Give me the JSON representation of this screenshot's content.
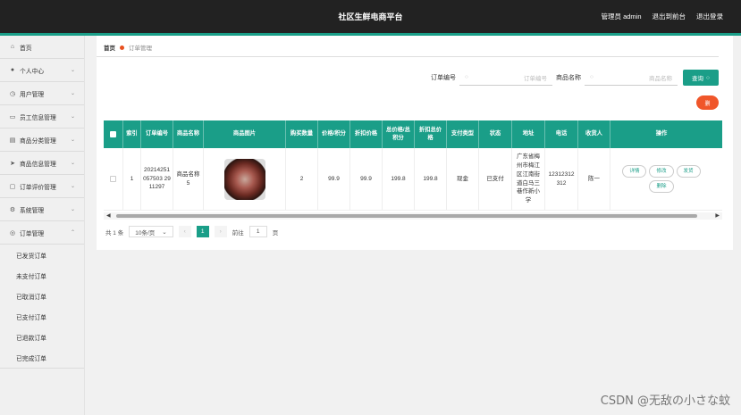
{
  "header": {
    "title": "社区生鲜电商平台",
    "admin": "管理员 admin",
    "back_to_front": "退出到前台",
    "logout": "退出登录"
  },
  "sidebar": {
    "items": [
      {
        "label": "首页",
        "icon": "home-icon"
      },
      {
        "label": "个人中心",
        "icon": "user-icon"
      },
      {
        "label": "用户管理",
        "icon": "clock-icon"
      },
      {
        "label": "员工信息管理",
        "icon": "monitor-icon"
      },
      {
        "label": "商品分类管理",
        "icon": "card-icon"
      },
      {
        "label": "商品信息管理",
        "icon": "send-icon"
      },
      {
        "label": "订单评价管理",
        "icon": "chat-icon"
      },
      {
        "label": "系统管理",
        "icon": "settings-icon"
      },
      {
        "label": "订单管理",
        "icon": "order-icon"
      }
    ],
    "sub_items": [
      "已发货订单",
      "未支付订单",
      "已取消订单",
      "已支付订单",
      "已退款订单",
      "已完成订单"
    ]
  },
  "breadcrumb": {
    "home": "首页",
    "current": "订单管理"
  },
  "search": {
    "order_no_label": "订单编号",
    "order_no_placeholder": "订单编号",
    "product_label": "商品名称",
    "product_placeholder": "商品名称",
    "query_button": "查询",
    "delete_button": "删"
  },
  "table": {
    "headers": [
      "索引",
      "订单编号",
      "商品名称",
      "商品图片",
      "购买数量",
      "价格/积分",
      "折扣价格",
      "总价格/总积分",
      "折扣总价格",
      "支付类型",
      "状态",
      "地址",
      "电话",
      "收货人",
      "操作"
    ],
    "rows": [
      {
        "index": "1",
        "order_no": "20214251057503 2911297",
        "product": "商品名称5",
        "qty": "2",
        "price": "99.9",
        "discount_price": "99.9",
        "total": "199.8",
        "discount_total": "199.8",
        "pay_type": "现金",
        "status": "已支付",
        "address": "广东省梅州市梅江区江南街道白马三巷作新小学",
        "phone": "12312312312",
        "receiver": "陈一"
      }
    ],
    "actions": [
      "详情",
      "修改",
      "发货",
      "删除"
    ]
  },
  "pager": {
    "total": "共 1 条",
    "page_size": "10条/页",
    "current_page": "1",
    "goto_label": "前往",
    "goto_value": "1",
    "page_unit": "页"
  },
  "watermark": "CSDN @无敌の小さな蚊",
  "colors": {
    "accent": "#1a9e88",
    "topbar": "#222222",
    "delete": "#f0562a"
  }
}
